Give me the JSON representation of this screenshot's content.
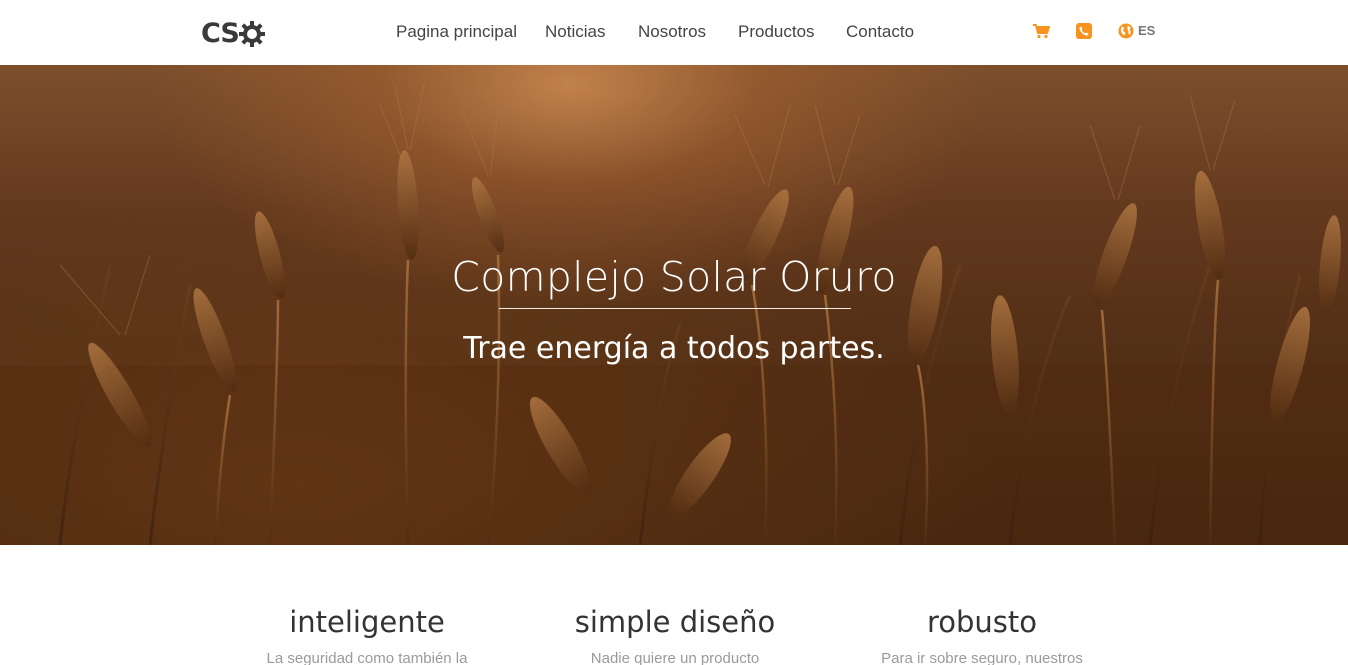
{
  "brand": {
    "logo_text": "CS",
    "logo_mark": "gear-icon"
  },
  "nav": {
    "items": [
      {
        "label": "Pagina principal"
      },
      {
        "label": "Noticias"
      },
      {
        "label": "Nosotros"
      },
      {
        "label": "Productos"
      },
      {
        "label": "Contacto"
      }
    ]
  },
  "header_actions": {
    "cart_icon": "cart-icon",
    "phone_icon": "phone-icon",
    "language_icon": "globe-icon",
    "language_label": "ES",
    "accent_color": "#f7931e"
  },
  "hero": {
    "title": "Complejo Solar Oruro",
    "subtitle": "Trae energía a todos partes."
  },
  "features": [
    {
      "title": "inteligente",
      "text": "La seguridad como también la"
    },
    {
      "title": "simple diseño",
      "text": "Nadie quiere un producto"
    },
    {
      "title": "robusto",
      "text": "Para ir sobre seguro, nuestros"
    }
  ]
}
